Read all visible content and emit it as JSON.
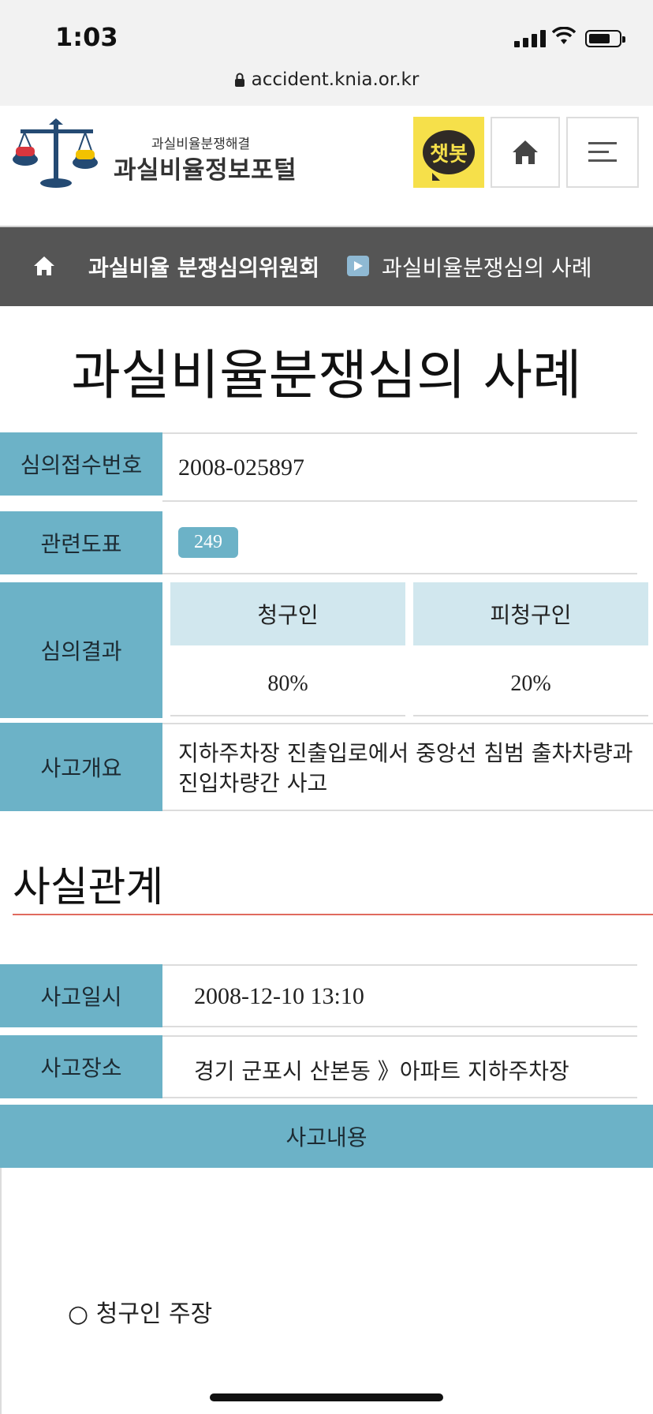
{
  "status": {
    "time": "1:03",
    "url": "accident.knia.or.kr"
  },
  "header": {
    "logo_sub": "과실비율분쟁해결",
    "logo_main": "과실비율정보포털",
    "chatbot_label": "챗봇"
  },
  "breadcrumb": {
    "level1": "과실비율 분쟁심의위원회",
    "level2": "과실비율분쟁심의 사례"
  },
  "page_title": "과실비율분쟁심의 사례",
  "info": {
    "case_no_label": "심의접수번호",
    "case_no": "2008-025897",
    "chart_label": "관련도표",
    "chart_no": "249",
    "result_label": "심의결과",
    "claimant_label": "청구인",
    "respondent_label": "피청구인",
    "claimant_ratio": "80%",
    "respondent_ratio": "20%",
    "summary_label": "사고개요",
    "summary": "지하주차장 진출입로에서 중앙선 침범 출차차량과 진입차량간 사고"
  },
  "facts": {
    "title": "사실관계",
    "date_label": "사고일시",
    "date": "2008-12-10 13:10",
    "place_label": "사고장소",
    "place": "경기 군포시 산본동 》아파트 지하주차장",
    "content_label": "사고내용",
    "claimant_claim": "○ 청구인 주장"
  },
  "colors": {
    "label_bg": "#6cb2c7",
    "breadcrumb_bg": "#555555",
    "accent_line": "#e06a5e",
    "chatbot_bg": "#f6e04a"
  }
}
